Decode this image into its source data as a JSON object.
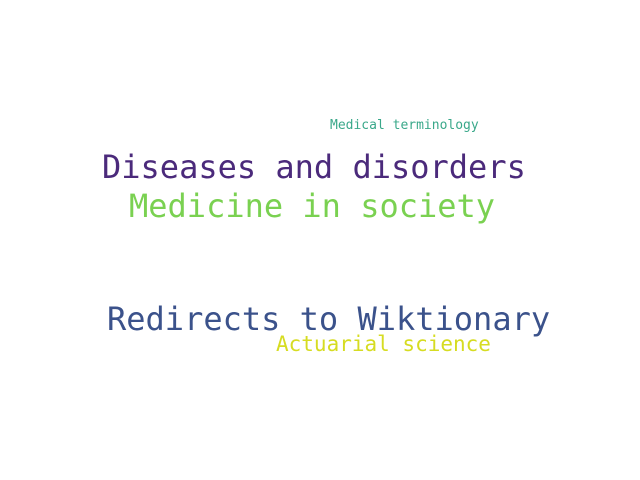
{
  "words": {
    "medical_terminology": {
      "text": "Medical terminology",
      "color": "#3aa88a"
    },
    "diseases_and_disorders": {
      "text": "Diseases and disorders",
      "color": "#4b2a7b"
    },
    "medicine_in_society": {
      "text": "Medicine in society",
      "color": "#7ad151"
    },
    "redirects_to_wiktionary": {
      "text": "Redirects to Wiktionary",
      "color": "#3b528b"
    },
    "actuarial_science": {
      "text": "Actuarial science",
      "color": "#d6dc22"
    }
  },
  "background_color": "#ffffff"
}
